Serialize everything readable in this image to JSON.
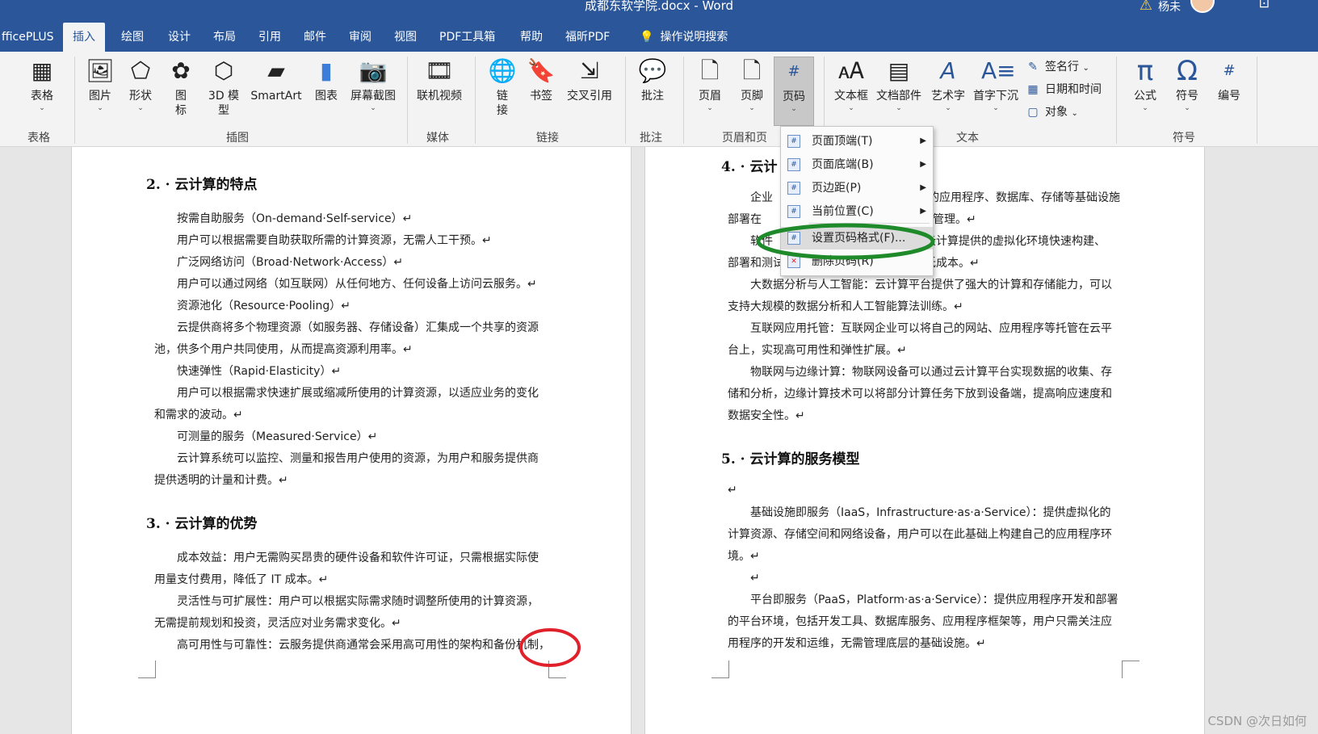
{
  "window": {
    "title": "成都东软学院.docx  -  Word",
    "user": "杨未"
  },
  "tabs": [
    "fficePLUS",
    "插入",
    "绘图",
    "设计",
    "布局",
    "引用",
    "邮件",
    "审阅",
    "视图",
    "PDF工具箱",
    "帮助",
    "福昕PDF",
    "操作说明搜索"
  ],
  "ribbon": {
    "groups": [
      "表格",
      "插图",
      "媒体",
      "链接",
      "批注",
      "页眉和页",
      "文本",
      "符号"
    ],
    "buttons": {
      "table": "表格",
      "picture": "图片",
      "shapes": "形状",
      "icons": "图\n标",
      "model3d": "3D 模\n型",
      "smartart": "SmartArt",
      "chart": "图表",
      "screenshot": "屏幕截图",
      "video": "联机视频",
      "link": "链\n接",
      "bookmark": "书签",
      "crossref": "交叉引用",
      "comment": "批注",
      "header": "页眉",
      "footer": "页脚",
      "pagenum": "页码",
      "textbox": "文本框",
      "quickparts": "文档部件",
      "wordart": "艺术字",
      "dropcap": "首字下沉",
      "signature": "签名行",
      "datetime": "日期和时间",
      "object": "对象",
      "equation": "公式",
      "symbol": "符号",
      "number": "编号"
    }
  },
  "menu": {
    "items": [
      {
        "label": "页面顶端(T)",
        "sub": true
      },
      {
        "label": "页面底端(B)",
        "sub": true
      },
      {
        "label": "页边距(P)",
        "sub": true
      },
      {
        "label": "当前位置(C)",
        "sub": true
      },
      {
        "label": "设置页码格式(F)...",
        "sub": false
      },
      {
        "label": "删除页码(R)",
        "sub": false
      }
    ]
  },
  "left_page": {
    "h2": "2. · 云计算的特点",
    "p": [
      "按需自助服务（On-demand·Self-service）↵",
      "用户可以根据需要自助获取所需的计算资源，无需人工干预。↵",
      "广泛网络访问（Broad·Network·Access）↵",
      "用户可以通过网络（如互联网）从任何地方、任何设备上访问云服务。↵",
      "资源池化（Resource·Pooling）↵",
      "云提供商将多个物理资源（如服务器、存储设备）汇集成一个共享的资源",
      "池，供多个用户共同使用，从而提高资源利用率。↵",
      "快速弹性（Rapid·Elasticity）↵",
      "用户可以根据需求快速扩展或缩减所使用的计算资源，以适应业务的变化",
      "和需求的波动。↵",
      "可测量的服务（Measured·Service）↵",
      "云计算系统可以监控、测量和报告用户使用的资源，为用户和服务提供商",
      "提供透明的计量和计费。↵"
    ],
    "h3": "3. · 云计算的优势",
    "p3": [
      "成本效益：用户无需购买昂贵的硬件设备和软件许可证，只需根据实际使",
      "用量支付费用，降低了 IT 成本。↵",
      "灵活性与可扩展性：用户可以根据实际需求随时调整所使用的计算资源，",
      "无需提前规划和投资，灵活应对业务需求变化。↵",
      "高可用性与可靠性：云服务提供商通常会采用高可用性的架构和备份机制，"
    ]
  },
  "right_page": {
    "h4": "4. · 云计",
    "p": [
      "企业",
      "的应用程序、数据库、存储等基础设施",
      "部署在",
      "管理。↵",
      "软件",
      "云计算提供的虚拟化环境快速构建、",
      "部署和测试",
      "低成本。↵",
      "大数据分析与人工智能：云计算平台提供了强大的计算和存储能力，可以",
      "支持大规模的数据分析和人工智能算法训练。↵",
      "互联网应用托管：互联网企业可以将自己的网站、应用程序等托管在云平",
      "台上，实现高可用性和弹性扩展。↵",
      "物联网与边缘计算：物联网设备可以通过云计算平台实现数据的收集、存",
      "储和分析，边缘计算技术可以将部分计算任务下放到设备端，提高响应速度和",
      "数据安全性。↵"
    ],
    "h5": "5. · 云计算的服务模型",
    "p5": [
      "↵",
      "基础设施即服务（IaaS，Infrastructure·as·a·Service）：提供虚拟化的",
      "计算资源、存储空间和网络设备，用户可以在此基础上构建自己的应用程序环",
      "境。↵",
      "↵",
      "平台即服务（PaaS，Platform·as·a·Service）：提供应用程序开发和部署",
      "的平台环境，包括开发工具、数据库服务、应用程序框架等，用户只需关注应",
      "用程序的开发和运维，无需管理底层的基础设施。↵"
    ]
  },
  "watermark": "CSDN @次日如何"
}
